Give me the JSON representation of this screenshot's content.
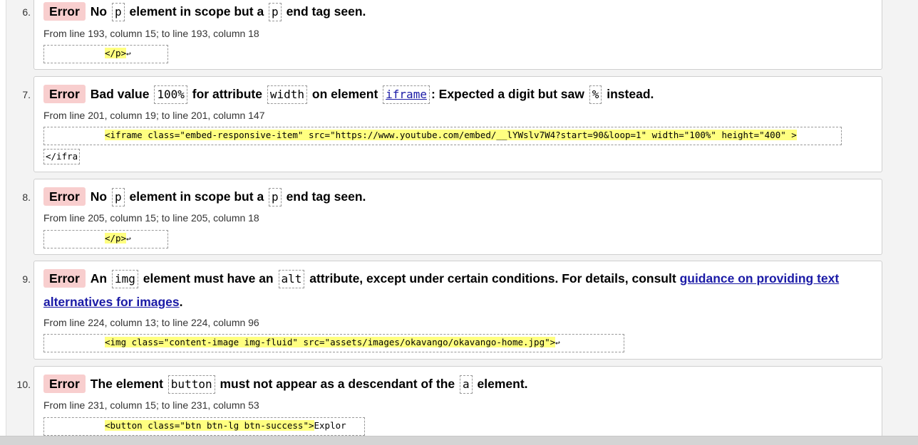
{
  "badge": "Error",
  "errors": [
    {
      "number": "6.",
      "msg_pre": "No",
      "code_1": "p",
      "msg_mid": "element in scope but a",
      "code_2": "p",
      "msg_post": "end tag seen.",
      "location": "From line 193, column 15; to line 193, column 18",
      "extract_highlight": "</p>",
      "extract_tail": "↩"
    },
    {
      "number": "7.",
      "msg_1": "Bad value",
      "code_1": "100%",
      "msg_2": "for attribute",
      "code_2": "width",
      "msg_3": "on element",
      "code_3": "iframe",
      "msg_4": ": Expected a digit but saw",
      "code_4": "%",
      "msg_5": "instead.",
      "location": "From line 201, column 19; to line 201, column 147",
      "extract_highlight": "<iframe class=\"embed-responsive-item\" src=\"https://www.youtube.com/embed/__lYWslv7W4?start=90&loop=1\" width=\"100%\" height=\"400\" >",
      "extract_continuation": "</ifra"
    },
    {
      "number": "8.",
      "msg_pre": "No",
      "code_1": "p",
      "msg_mid": "element in scope but a",
      "code_2": "p",
      "msg_post": "end tag seen.",
      "location": "From line 205, column 15; to line 205, column 18",
      "extract_highlight": "</p>",
      "extract_tail": "↩"
    },
    {
      "number": "9.",
      "msg_1": "An",
      "code_1": "img",
      "msg_2": "element must have an",
      "code_2": "alt",
      "msg_3": "attribute, except under certain conditions. For details, consult",
      "link": "guidance on providing text alternatives for images",
      "msg_end": ".",
      "location": "From line 224, column 13; to line 224, column 96",
      "extract_highlight": "<img class=\"content-image img-fluid\" src=\"assets/images/okavango/okavango-home.jpg\">",
      "extract_tail": "↩"
    },
    {
      "number": "10.",
      "msg_1": "The element",
      "code_1": "button",
      "msg_2": "must not appear as a descendant of the",
      "code_2": "a",
      "msg_3": "element.",
      "location": "From line 231, column 15; to line 231, column 53",
      "extract_highlight": "<button class=\"btn btn-lg btn-success\">",
      "extract_tail": "Explor"
    }
  ]
}
